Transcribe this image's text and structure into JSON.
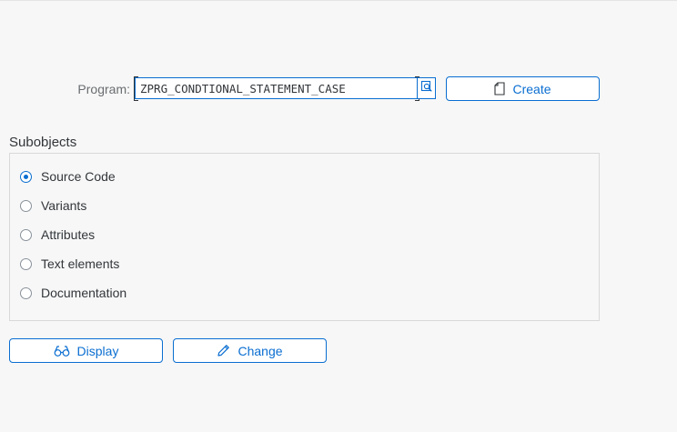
{
  "program": {
    "label": "Program:",
    "value": "ZPRG_CONDTIONAL_STATEMENT_CASE",
    "value_help_icon": "value-help-icon"
  },
  "create_button": {
    "label": "Create",
    "icon": "document-icon"
  },
  "subobjects": {
    "title": "Subobjects",
    "selected": "Source Code",
    "options": [
      {
        "label": "Source Code",
        "checked": true
      },
      {
        "label": "Variants",
        "checked": false
      },
      {
        "label": "Attributes",
        "checked": false
      },
      {
        "label": "Text elements",
        "checked": false
      },
      {
        "label": "Documentation",
        "checked": false
      }
    ]
  },
  "actions": {
    "display_label": "Display",
    "display_icon": "glasses-icon",
    "change_label": "Change",
    "change_icon": "pencil-icon"
  },
  "colors": {
    "accent": "#0a6ed1",
    "background": "#f7f7f7",
    "text": "#32363a",
    "label": "#6a6d70"
  }
}
